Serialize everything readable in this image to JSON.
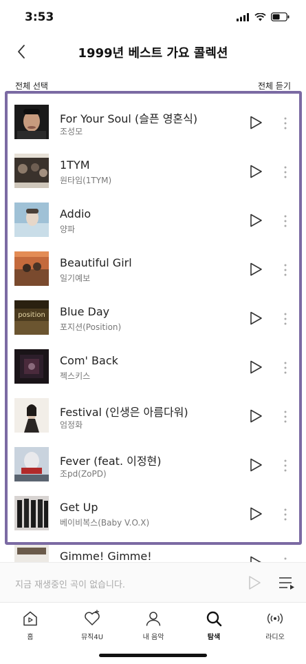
{
  "status_bar": {
    "time": "3:53"
  },
  "header": {
    "title": "1999년 베스트 가요 콜렉션"
  },
  "actions": {
    "select_all": "전체 선택",
    "play_all": "전체 듣기"
  },
  "tracks": [
    {
      "title": "For Your Soul (슬픈 영혼식)",
      "artist": "조성모"
    },
    {
      "title": "1TYM",
      "artist": "원타임(1TYM)"
    },
    {
      "title": "Addio",
      "artist": "양파"
    },
    {
      "title": "Beautiful Girl",
      "artist": "일기예보"
    },
    {
      "title": "Blue Day",
      "artist": "포지션(Position)"
    },
    {
      "title": "Com' Back",
      "artist": "젝스키스"
    },
    {
      "title": "Festival (인생은 아름다워)",
      "artist": "엄정화"
    },
    {
      "title": "Fever (feat. 이정현)",
      "artist": "조pd(ZoPD)"
    },
    {
      "title": "Get Up",
      "artist": "베이비복스(Baby V.O.X)"
    },
    {
      "title": "Gimme! Gimme!",
      "artist": ""
    }
  ],
  "album_art": {
    "blue_day_cover_text": "position"
  },
  "mini_player": {
    "message": "지금 재생중인 곡이 없습니다."
  },
  "tabs": [
    {
      "label": "홈",
      "icon": "home-icon"
    },
    {
      "label": "뮤직4U",
      "icon": "heart-icon"
    },
    {
      "label": "내 음악",
      "icon": "person-icon"
    },
    {
      "label": "탐색",
      "icon": "search-icon",
      "active": true
    },
    {
      "label": "라디오",
      "icon": "radio-icon"
    }
  ],
  "colors": {
    "frame": "#7b6aa3",
    "text": "#222222",
    "subtext": "#777777"
  }
}
